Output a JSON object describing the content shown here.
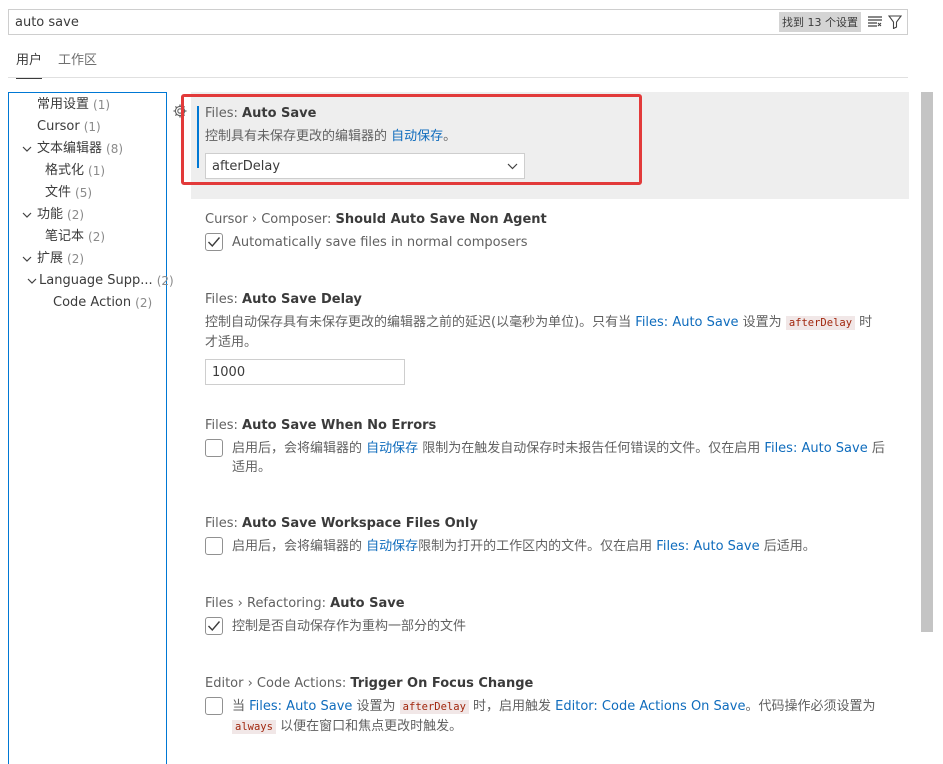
{
  "search": {
    "value": "auto save",
    "result_count": "找到 13 个设置",
    "clear_filter_icon": "filter-list-icon",
    "filter_icon": "funnel-icon"
  },
  "tabs": [
    {
      "label": "用户",
      "active": true
    },
    {
      "label": "工作区",
      "active": false
    }
  ],
  "toc": [
    {
      "label": "常用设置",
      "count": "(1)",
      "indent": 1,
      "expandable": false
    },
    {
      "label": "Cursor",
      "count": "(1)",
      "indent": 1,
      "expandable": false
    },
    {
      "label": "文本编辑器",
      "count": "(8)",
      "indent": 0,
      "expandable": true
    },
    {
      "label": "格式化",
      "count": "(1)",
      "indent": 2,
      "expandable": false
    },
    {
      "label": "文件",
      "count": "(5)",
      "indent": 2,
      "expandable": false
    },
    {
      "label": "功能",
      "count": "(2)",
      "indent": 0,
      "expandable": true
    },
    {
      "label": "笔记本",
      "count": "(2)",
      "indent": 2,
      "expandable": false
    },
    {
      "label": "扩展",
      "count": "(2)",
      "indent": 0,
      "expandable": true
    },
    {
      "label": "Language Supp...",
      "count": "(2)",
      "indent": 1,
      "expandable": true
    },
    {
      "label": "Code Action",
      "count": "(2)",
      "indent": 3,
      "expandable": false
    }
  ],
  "settings": {
    "auto_save": {
      "prefix": "Files: ",
      "name": "Auto Save",
      "desc_before": "控制具有未保存更改的编辑器的 ",
      "desc_link": "自动保存",
      "desc_after": "。",
      "value": "afterDelay"
    },
    "composer": {
      "prefix": "Cursor › Composer: ",
      "name": "Should Auto Save Non Agent",
      "label": "Automatically save files in normal composers",
      "checked": true
    },
    "delay": {
      "prefix": "Files: ",
      "name": "Auto Save Delay",
      "desc_before": "控制自动保存具有未保存更改的编辑器之前的延迟(以毫秒为单位)。只有当 ",
      "desc_link": "Files: Auto Save",
      "desc_mid": " 设置为 ",
      "desc_code": "afterDelay",
      "desc_after": " 时才适用。",
      "value": "1000"
    },
    "no_errors": {
      "prefix": "Files: ",
      "name": "Auto Save When No Errors",
      "desc_before": "启用后，会将编辑器的 ",
      "desc_link": "自动保存",
      "desc_mid": " 限制为在触发自动保存时未报告任何错误的文件。仅在启用 ",
      "desc_link2": "Files: Auto Save",
      "desc_after": " 后适用。",
      "checked": false
    },
    "workspace_only": {
      "prefix": "Files: ",
      "name": "Auto Save Workspace Files Only",
      "desc_before": "启用后，会将编辑器的 ",
      "desc_link": "自动保存",
      "desc_mid": "限制为打开的工作区内的文件。仅在启用 ",
      "desc_link2": "Files: Auto Save",
      "desc_after": " 后适用。",
      "checked": false
    },
    "refactoring": {
      "prefix": "Files › Refactoring: ",
      "name": "Auto Save",
      "label": "控制是否自动保存作为重构一部分的文件",
      "checked": true
    },
    "code_actions": {
      "prefix": "Editor › Code Actions: ",
      "name": "Trigger On Focus Change",
      "desc_before": "当 ",
      "desc_link": "Files: Auto Save",
      "desc_mid": " 设置为 ",
      "desc_code": "afterDelay",
      "desc_mid2": " 时，启用触发 ",
      "desc_link2": "Editor: Code Actions On Save",
      "desc_mid3": "。代码操作必须设置为 ",
      "desc_code2": "always",
      "desc_after": " 以便在窗口和焦点更改时触发。",
      "checked": false
    }
  },
  "colors": {
    "accent": "#0078d4",
    "link": "#0f6cbd",
    "highlight": "#e23a3a"
  }
}
